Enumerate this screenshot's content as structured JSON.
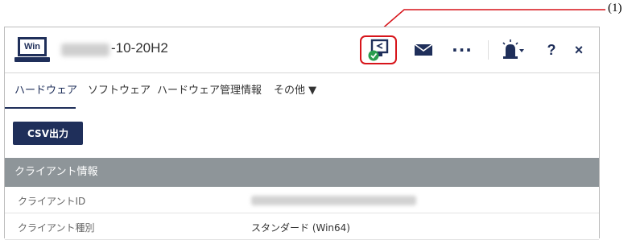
{
  "callout": {
    "label": "(1)",
    "color": "#d7141a"
  },
  "titlebar": {
    "app_icon_text": "Win",
    "host_suffix": "-10-20H2",
    "buttons": {
      "remote_icon": "remote-control-check-icon",
      "mail_icon": "mail-icon",
      "more": "···",
      "alarm_icon": "alarm-beacon-icon",
      "help": "?",
      "close": "×"
    }
  },
  "tabs": [
    {
      "label": "ハードウェア",
      "active": true
    },
    {
      "label": "ソフトウェア",
      "active": false
    },
    {
      "label": "ハードウェア管理情報",
      "active": false
    },
    {
      "label": "その他 ▼",
      "active": false
    }
  ],
  "toolbar": {
    "csv_label": "CSV出力"
  },
  "section": {
    "title": "クライアント情報",
    "rows": [
      {
        "key": "クライアントID",
        "value": ""
      },
      {
        "key": "クライアント種別",
        "value": "スタンダード (Win64)"
      }
    ]
  },
  "colors": {
    "brand": "#1f2f5a",
    "section_bg": "#8e9599",
    "check": "#2a9d4f"
  }
}
